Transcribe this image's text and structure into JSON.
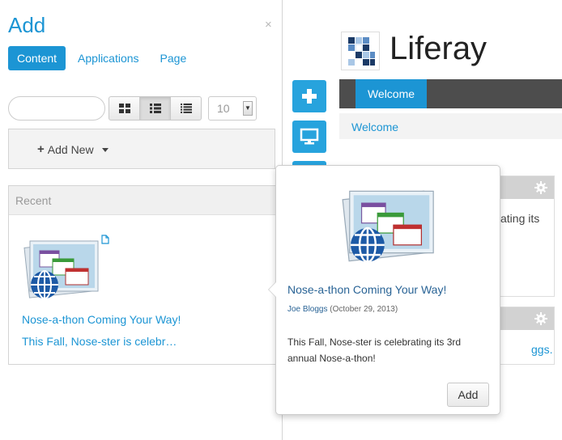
{
  "add_panel": {
    "title": "Add",
    "close_glyph": "×",
    "tabs": [
      {
        "label": "Content",
        "active": true
      },
      {
        "label": "Applications",
        "active": false
      },
      {
        "label": "Page",
        "active": false
      }
    ],
    "search": {
      "value": "",
      "placeholder": ""
    },
    "view_modes": [
      "icon-view",
      "descriptive-view",
      "list-view"
    ],
    "active_view": "descriptive-view",
    "per_page": "10",
    "add_new_label": "Add New",
    "recent": {
      "header": "Recent",
      "item": {
        "title": "Nose-a-thon Coming Your Way!",
        "summary": "This Fall, Nose-ster is celebr…"
      }
    }
  },
  "portal": {
    "site_name": "Liferay",
    "nav": {
      "items": [
        {
          "label": "Welcome",
          "active": true
        }
      ]
    },
    "breadcrumb": "Welcome",
    "portlet1_text": "ating its",
    "portlet2_text": "ggs."
  },
  "popover": {
    "title": "Nose-a-thon Coming Your Way!",
    "author": "Joe Bloggs",
    "date": "(October 29, 2013)",
    "body": "This Fall, Nose-ster is celebrating its 3rd annual Nose-a-thon!",
    "add_label": "Add"
  },
  "colors": {
    "accent": "#1c95d4",
    "dock": "#27a3dd",
    "navbar": "#4d4d4d",
    "link_dark": "#2a6496"
  }
}
